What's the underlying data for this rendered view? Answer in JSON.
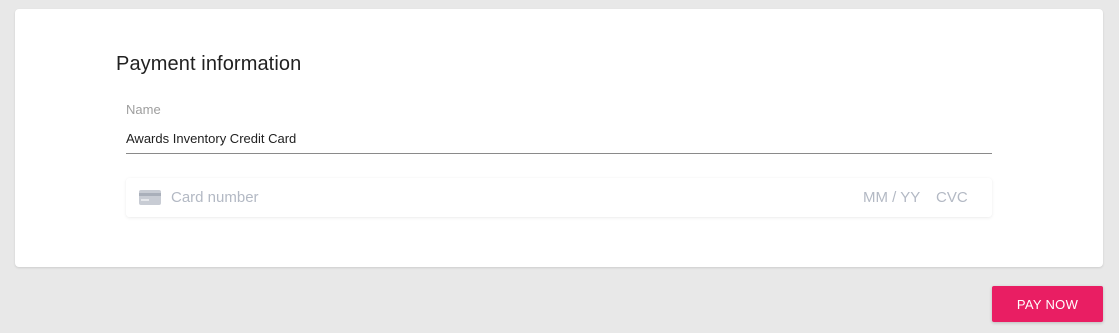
{
  "payment": {
    "title": "Payment information",
    "name_label": "Name",
    "name_value": "Awards Inventory Credit Card",
    "card_number_placeholder": "Card number",
    "expiry_placeholder": "MM / YY",
    "cvc_placeholder": "CVC",
    "card_icon": "credit-card-icon"
  },
  "actions": {
    "pay_label": "PAY NOW"
  },
  "colors": {
    "accent": "#e91e63",
    "background": "#e8e8e8",
    "placeholder": "#b3b9c4"
  }
}
